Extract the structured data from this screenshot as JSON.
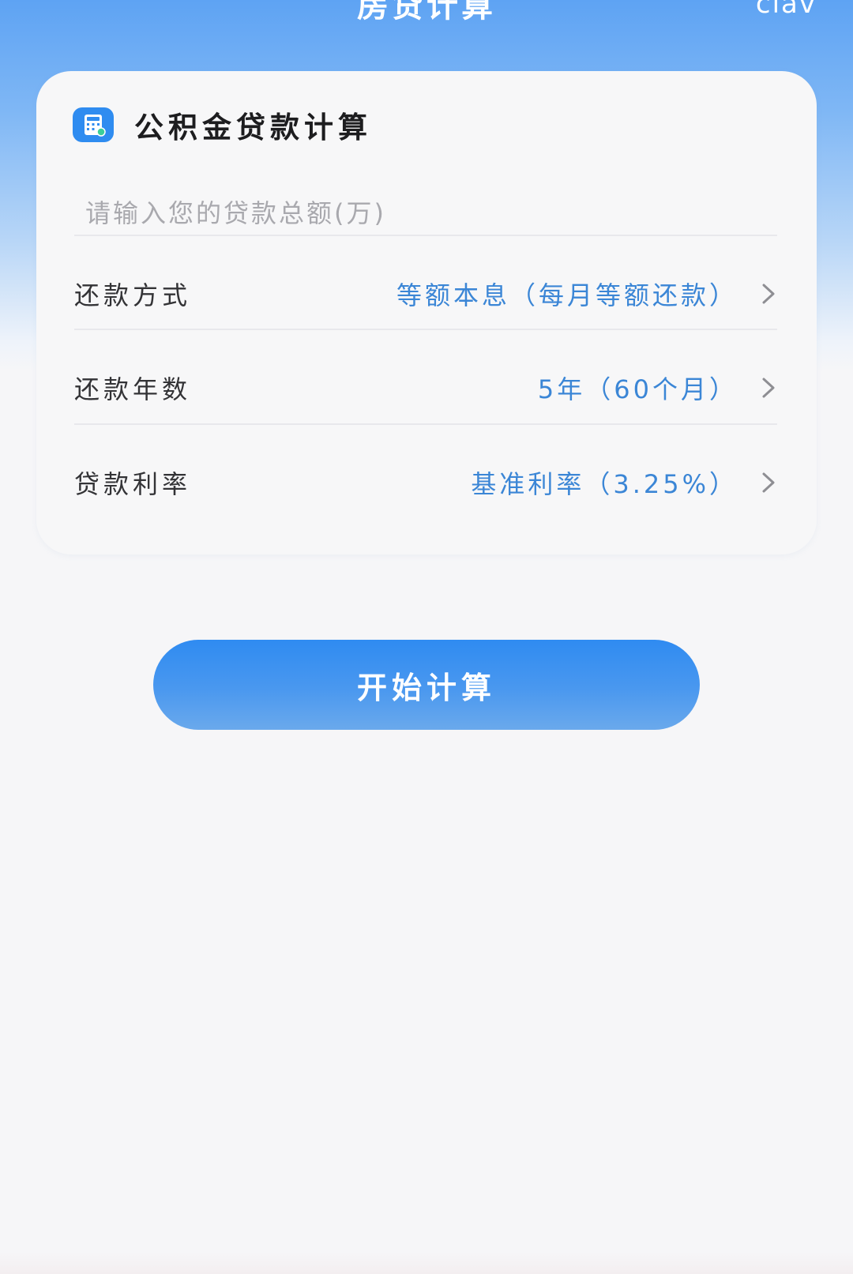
{
  "header": {
    "title": "房贷计算",
    "right_text": "clav"
  },
  "card": {
    "title": "公积金贷款计算",
    "amount_input": {
      "value": "",
      "placeholder": "请输入您的贷款总额(万)"
    },
    "rows": [
      {
        "label": "还款方式",
        "value": "等额本息（每月等额还款）"
      },
      {
        "label": "还款年数",
        "value": "5年（60个月）"
      },
      {
        "label": "贷款利率",
        "value": "基准利率（3.25%）"
      }
    ]
  },
  "actions": {
    "start_label": "开始计算"
  },
  "icons": {
    "card_icon": "calculator-icon",
    "row_arrow": "chevron-right-icon"
  },
  "colors": {
    "accent": "#2f8cf0",
    "value_text": "#3b86d6",
    "background": "#f6f6f8"
  }
}
